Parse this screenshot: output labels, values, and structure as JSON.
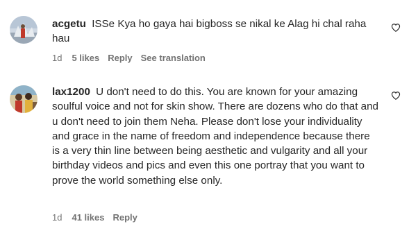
{
  "comments": [
    {
      "username": "acgetu",
      "text": "ISSe Kya ho gaya hai bigboss se nikal ke Alag hi chal raha hau",
      "time": "1d",
      "likes": "5 likes",
      "reply": "Reply",
      "translation": "See translation"
    },
    {
      "username": "lax1200",
      "text": "U don't need to do this. You are known for your amazing soulful voice and not for skin show. There are dozens who do that and u don't need to join them Neha. Please don't lose your individuality and grace in the name of freedom and independence because there is a very thin line between being aesthetic and vulgarity and all your birthday videos and pics and even this one portray that you want to prove the world something else only.",
      "time": "1d",
      "likes": "41 likes",
      "reply": "Reply"
    }
  ],
  "icons": {
    "like": "heart-icon"
  },
  "colors": {
    "text": "#262626",
    "meta": "#737373"
  }
}
